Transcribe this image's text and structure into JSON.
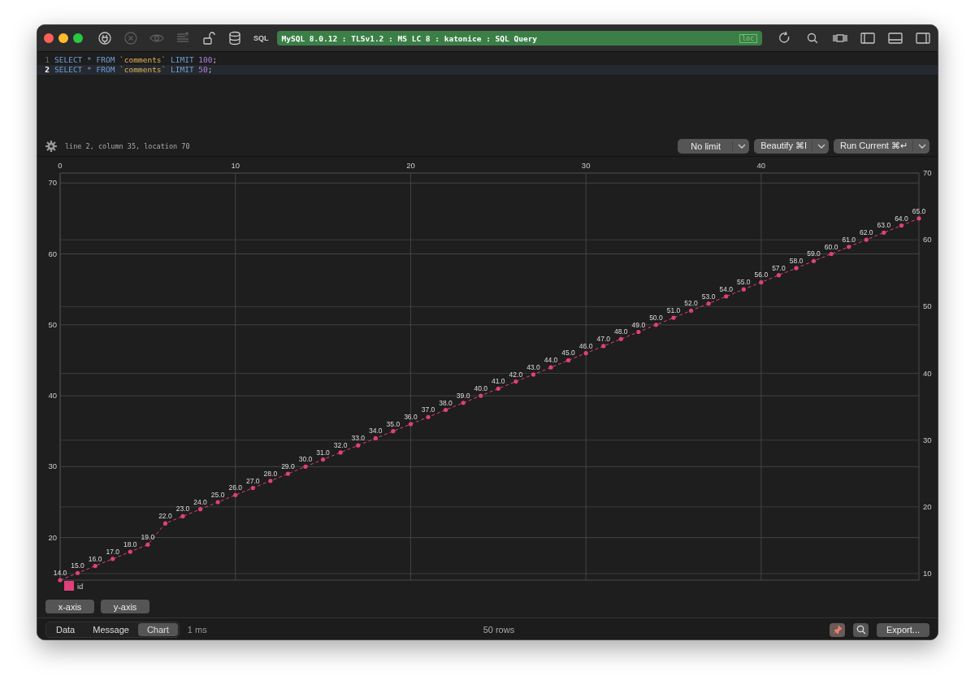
{
  "toolbar": {
    "left_buttons": [
      {
        "kind": "plug",
        "disabled": false
      },
      {
        "kind": "stop",
        "disabled": true
      },
      {
        "kind": "eye",
        "disabled": true
      },
      {
        "kind": "list",
        "disabled": true
      },
      {
        "kind": "unlock",
        "disabled": false
      },
      {
        "kind": "database",
        "disabled": false
      }
    ],
    "mode_label": "SQL",
    "status": {
      "text": "MySQL 8.0.12 : TLSv1.2 : MS LC 8 : katonice : SQL Query",
      "badge": "loc"
    },
    "right_buttons": [
      {
        "kind": "refresh",
        "disabled": false
      },
      {
        "kind": "search",
        "disabled": false
      },
      {
        "kind": "columns",
        "disabled": false
      },
      {
        "kind": "left-panel",
        "disabled": false
      },
      {
        "kind": "bottom-panel",
        "disabled": false
      },
      {
        "kind": "right-panel",
        "disabled": false
      }
    ]
  },
  "editor": {
    "lines": [
      {
        "number": "1",
        "current": false,
        "tokens": [
          {
            "kind": "keyword",
            "text": "SELECT"
          },
          {
            "kind": "operator",
            "text": "*"
          },
          {
            "kind": "keyword",
            "text": "FROM"
          },
          {
            "kind": "string",
            "text": "`comments`"
          },
          {
            "kind": "keyword",
            "text": "LIMIT"
          },
          {
            "kind": "number",
            "text": "100"
          },
          {
            "kind": "punct",
            "text": ";"
          }
        ]
      },
      {
        "number": "2",
        "current": true,
        "tokens": [
          {
            "kind": "keyword",
            "text": "SELECT"
          },
          {
            "kind": "operator",
            "text": "*"
          },
          {
            "kind": "keyword",
            "text": "FROM"
          },
          {
            "kind": "string",
            "text": "`comments`"
          },
          {
            "kind": "keyword",
            "text": "LIMIT"
          },
          {
            "kind": "number",
            "text": "50"
          },
          {
            "kind": "punct",
            "text": ";"
          }
        ]
      }
    ],
    "position": "line 2, column 35, location 70",
    "dropdowns": [
      "No limit",
      "Beautify ⌘I",
      "Run Current ⌘↵"
    ]
  },
  "chart": {
    "chart_data": {
      "type": "line",
      "x": [
        0,
        1,
        2,
        3,
        4,
        5,
        6,
        7,
        8,
        9,
        10,
        11,
        12,
        13,
        14,
        15,
        16,
        17,
        18,
        19,
        20,
        21,
        22,
        23,
        24,
        25,
        26,
        27,
        28,
        29,
        30,
        31,
        32,
        33,
        34,
        35,
        36,
        37,
        38,
        39,
        40,
        41,
        42,
        43,
        44,
        45,
        46,
        47,
        48,
        49
      ],
      "series": [
        {
          "name": "id",
          "color": "#e0407a",
          "line_style": "dashed",
          "values": [
            14,
            15,
            16,
            17,
            18,
            19,
            22,
            23,
            24,
            25,
            26,
            27,
            28,
            29,
            30,
            31,
            32,
            33,
            34,
            35,
            36,
            37,
            38,
            39,
            40,
            41,
            42,
            43,
            44,
            45,
            46,
            47,
            48,
            49,
            50,
            51,
            52,
            53,
            54,
            55,
            56,
            57,
            58,
            59,
            60,
            61,
            62,
            63,
            64,
            65
          ]
        }
      ],
      "value_labels": [
        "14.0",
        "15.0",
        "16.0",
        "17.0",
        "18.0",
        "19.0",
        "22.0",
        "23.0",
        "24.0",
        "25.0",
        "26.0",
        "27.0",
        "28.0",
        "29.0",
        "30.0",
        "31.0",
        "32.0",
        "33.0",
        "34.0",
        "35.0",
        "36.0",
        "37.0",
        "38.0",
        "39.0",
        "40.0",
        "41.0",
        "42.0",
        "43.0",
        "44.0",
        "45.0",
        "46.0",
        "47.0",
        "48.0",
        "49.0",
        "50.0",
        "51.0",
        "52.0",
        "53.0",
        "54.0",
        "55.0",
        "56.0",
        "57.0",
        "58.0",
        "59.0",
        "60.0",
        "61.0",
        "62.0",
        "63.0",
        "64.0",
        "65.0"
      ],
      "xlim": [
        0,
        49
      ],
      "ylim": [
        14,
        71.4
      ],
      "xticks": [
        0,
        10,
        20,
        30,
        40
      ],
      "yticks": [
        20,
        30,
        40,
        50,
        60,
        70
      ],
      "grid": true
    },
    "right_axis": {
      "ticks": [
        "70",
        "60",
        "50",
        "40",
        "30",
        "20",
        "10"
      ]
    },
    "axis_buttons": [
      "x-axis",
      "y-axis"
    ]
  },
  "bottom_bar": {
    "tabs": [
      {
        "label": "Data",
        "selected": false
      },
      {
        "label": "Message",
        "selected": false
      },
      {
        "label": "Chart",
        "selected": true
      }
    ],
    "time": "1 ms",
    "rows": "50 rows",
    "pin_active": true,
    "export": "Export..."
  }
}
